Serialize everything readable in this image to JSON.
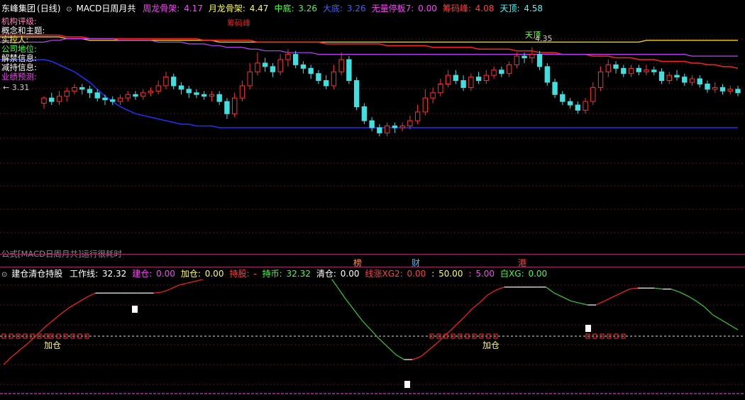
{
  "top_header": {
    "stock_name": "东峰集团",
    "period": "(日线)",
    "indicator_name": "MACD日周月共",
    "items": [
      {
        "label": "周龙骨架:",
        "value": "4.17",
        "color": "#ff40ff"
      },
      {
        "label": "月龙骨架:",
        "value": "4.47",
        "color": "#ffff40"
      },
      {
        "label": "中底:",
        "value": "3.26",
        "color": "#40ff40"
      },
      {
        "label": "大底:",
        "value": "3.26",
        "color": "#4060ff"
      },
      {
        "label": "无量停板7:",
        "value": "0.00",
        "color": "#ff40ff"
      },
      {
        "label": "筹码峰:",
        "value": "4.08",
        "color": "#ff4040"
      },
      {
        "label": "天顶:",
        "value": "4.58",
        "color": "#40ffff"
      }
    ]
  },
  "info_labels": [
    {
      "text": "机构评级:",
      "color": "#ff80c0"
    },
    {
      "text": "概念和主题:",
      "color": "#ffffff"
    },
    {
      "text": "实控人:",
      "color": "#ffff40"
    },
    {
      "text": "公司地位:",
      "color": "#40ff40"
    },
    {
      "text": "解禁信息:",
      "color": "#ffffff"
    },
    {
      "text": "减持信息:",
      "color": "#ffffff"
    },
    {
      "text": "业绩预测:",
      "color": "#ff40ff"
    }
  ],
  "price_labels": {
    "left_low": "← 3.31",
    "high": "4.35",
    "tag_red": "筹码峰",
    "tag_green": "天顶"
  },
  "notice": "公式[MACD日周月共]运行很耗时",
  "badges": [
    {
      "text": "榜",
      "color": "#ff9040"
    },
    {
      "text": "财",
      "color": "#40c0ff"
    },
    {
      "text": "港",
      "color": "#ff4040"
    }
  ],
  "lower_header": {
    "indicator_name": "建仓清仓持股",
    "items": [
      {
        "label": "工作线:",
        "value": "32.32",
        "color": "#ffffff"
      },
      {
        "label": "建仓:",
        "value": "0.00",
        "color": "#ff40ff"
      },
      {
        "label": "加仓:",
        "value": "0.00",
        "color": "#ffff40"
      },
      {
        "label": "持股:",
        "value": "-",
        "color": "#ff4040"
      },
      {
        "label": "持币:",
        "value": "32.32",
        "color": "#40ff40"
      },
      {
        "label": "清仓:",
        "value": "0.00",
        "color": "#ffffff"
      },
      {
        "label": "线涨XG2:",
        "value": "0.00",
        "color": "#ff4040"
      },
      {
        "label": ":",
        "value": "50.00",
        "color": "#ffff40"
      },
      {
        "label": ":",
        "value": "5.00",
        "color": "#ff40ff"
      },
      {
        "label": "白XG:",
        "value": "0.00",
        "color": "#40ff40"
      }
    ]
  },
  "lower_labels": {
    "add_1": "加仓",
    "add_2": "加仓"
  },
  "candles": [
    [
      4.09,
      4.12,
      4.06,
      4.13
    ],
    [
      4.12,
      4.1,
      4.08,
      4.15
    ],
    [
      4.1,
      4.13,
      4.08,
      4.16
    ],
    [
      4.13,
      4.16,
      4.1,
      4.18
    ],
    [
      4.16,
      4.18,
      4.14,
      4.2
    ],
    [
      4.18,
      4.17,
      4.14,
      4.2
    ],
    [
      4.17,
      4.15,
      4.12,
      4.19
    ],
    [
      4.15,
      4.12,
      4.1,
      4.17
    ],
    [
      4.12,
      4.11,
      4.08,
      4.14
    ],
    [
      4.11,
      4.1,
      4.08,
      4.13
    ],
    [
      4.1,
      4.12,
      4.08,
      4.14
    ],
    [
      4.12,
      4.14,
      4.1,
      4.16
    ],
    [
      4.14,
      4.13,
      4.11,
      4.16
    ],
    [
      4.13,
      4.15,
      4.11,
      4.17
    ],
    [
      4.15,
      4.16,
      4.13,
      4.18
    ],
    [
      4.16,
      4.19,
      4.14,
      4.22
    ],
    [
      4.19,
      4.24,
      4.17,
      4.27
    ],
    [
      4.24,
      4.19,
      4.17,
      4.26
    ],
    [
      4.19,
      4.17,
      4.14,
      4.21
    ],
    [
      4.17,
      4.15,
      4.12,
      4.19
    ],
    [
      4.15,
      4.14,
      4.12,
      4.17
    ],
    [
      4.14,
      4.13,
      4.11,
      4.16
    ],
    [
      4.13,
      4.14,
      4.1,
      4.16
    ],
    [
      4.14,
      4.1,
      4.08,
      4.16
    ],
    [
      4.1,
      4.03,
      4.0,
      4.12
    ],
    [
      4.03,
      4.12,
      4.01,
      4.15
    ],
    [
      4.12,
      4.19,
      4.1,
      4.22
    ],
    [
      4.19,
      4.27,
      4.17,
      4.32
    ],
    [
      4.27,
      4.32,
      4.25,
      4.38
    ],
    [
      4.32,
      4.3,
      4.27,
      4.35
    ],
    [
      4.3,
      4.27,
      4.24,
      4.32
    ],
    [
      4.27,
      4.34,
      4.25,
      4.37
    ],
    [
      4.34,
      4.37,
      4.3,
      4.4
    ],
    [
      4.37,
      4.31,
      4.29,
      4.39
    ],
    [
      4.31,
      4.29,
      4.26,
      4.33
    ],
    [
      4.29,
      4.26,
      4.23,
      4.31
    ],
    [
      4.26,
      4.22,
      4.2,
      4.28
    ],
    [
      4.22,
      4.19,
      4.17,
      4.25
    ],
    [
      4.19,
      4.27,
      4.17,
      4.31
    ],
    [
      4.27,
      4.34,
      4.25,
      4.38
    ],
    [
      4.34,
      4.22,
      4.2,
      4.36
    ],
    [
      4.22,
      4.07,
      4.05,
      4.24
    ],
    [
      4.07,
      3.99,
      3.97,
      4.09
    ],
    [
      3.99,
      3.95,
      3.93,
      4.01
    ],
    [
      3.95,
      3.92,
      3.9,
      3.97
    ],
    [
      3.92,
      3.96,
      3.9,
      3.98
    ],
    [
      3.96,
      3.95,
      3.92,
      3.98
    ],
    [
      3.95,
      3.96,
      3.93,
      3.98
    ],
    [
      3.96,
      3.99,
      3.94,
      4.02
    ],
    [
      3.99,
      4.04,
      3.97,
      4.08
    ],
    [
      4.04,
      4.12,
      4.02,
      4.17
    ],
    [
      4.12,
      4.15,
      4.09,
      4.18
    ],
    [
      4.15,
      4.2,
      4.13,
      4.23
    ],
    [
      4.2,
      4.25,
      4.18,
      4.28
    ],
    [
      4.25,
      4.22,
      4.2,
      4.28
    ],
    [
      4.22,
      4.18,
      4.16,
      4.25
    ],
    [
      4.18,
      4.24,
      4.16,
      4.26
    ],
    [
      4.24,
      4.22,
      4.2,
      4.27
    ],
    [
      4.22,
      4.25,
      4.2,
      4.28
    ],
    [
      4.25,
      4.28,
      4.23,
      4.3
    ],
    [
      4.28,
      4.26,
      4.24,
      4.3
    ],
    [
      4.26,
      4.31,
      4.24,
      4.33
    ],
    [
      4.31,
      4.36,
      4.29,
      4.38
    ],
    [
      4.36,
      4.35,
      4.32,
      4.38
    ],
    [
      4.35,
      4.37,
      4.32,
      4.41
    ],
    [
      4.37,
      4.3,
      4.28,
      4.39
    ],
    [
      4.3,
      4.21,
      4.19,
      4.32
    ],
    [
      4.21,
      4.14,
      4.12,
      4.23
    ],
    [
      4.14,
      4.1,
      4.08,
      4.16
    ],
    [
      4.1,
      4.08,
      4.06,
      4.12
    ],
    [
      4.08,
      4.05,
      4.03,
      4.1
    ],
    [
      4.05,
      4.1,
      4.03,
      4.12
    ],
    [
      4.1,
      4.18,
      4.08,
      4.21
    ],
    [
      4.18,
      4.27,
      4.16,
      4.3
    ],
    [
      4.27,
      4.31,
      4.24,
      4.34
    ],
    [
      4.31,
      4.29,
      4.26,
      4.33
    ],
    [
      4.29,
      4.26,
      4.24,
      4.31
    ],
    [
      4.26,
      4.29,
      4.24,
      4.31
    ],
    [
      4.29,
      4.27,
      4.25,
      4.31
    ],
    [
      4.27,
      4.28,
      4.25,
      4.31
    ],
    [
      4.28,
      4.27,
      4.25,
      4.3
    ],
    [
      4.27,
      4.22,
      4.2,
      4.29
    ],
    [
      4.22,
      4.25,
      4.2,
      4.27
    ],
    [
      4.25,
      4.24,
      4.22,
      4.28
    ],
    [
      4.24,
      4.21,
      4.19,
      4.26
    ],
    [
      4.21,
      4.23,
      4.19,
      4.25
    ],
    [
      4.23,
      4.2,
      4.18,
      4.25
    ],
    [
      4.2,
      4.17,
      4.15,
      4.22
    ],
    [
      4.17,
      4.18,
      4.15,
      4.21
    ],
    [
      4.18,
      4.16,
      4.14,
      4.2
    ],
    [
      4.16,
      4.17,
      4.14,
      4.19
    ],
    [
      4.17,
      4.15,
      4.13,
      4.19
    ]
  ],
  "yellow_line": [
    4.47,
    4.47,
    4.47,
    4.46,
    4.46,
    4.46,
    4.45,
    4.45,
    4.45,
    4.45,
    4.45,
    4.45,
    4.45,
    4.45,
    4.45,
    4.45,
    4.45,
    4.45,
    4.45,
    4.45,
    4.45,
    4.45,
    4.45,
    4.44,
    4.44,
    4.44,
    4.44,
    4.44,
    4.44,
    4.44,
    4.44,
    4.44,
    4.44,
    4.44,
    4.44,
    4.44,
    4.44,
    4.44,
    4.44,
    4.44,
    4.44,
    4.44,
    4.44,
    4.44,
    4.44,
    4.44,
    4.44,
    4.44,
    4.44,
    4.44,
    4.44,
    4.44,
    4.44,
    4.44,
    4.44,
    4.44,
    4.44,
    4.44,
    4.44,
    4.44,
    4.44,
    4.44,
    4.44,
    4.44,
    4.44,
    4.44,
    4.44,
    4.44,
    4.44,
    4.44,
    4.44,
    4.44,
    4.44,
    4.44,
    4.44,
    4.44,
    4.44,
    4.44,
    4.44,
    4.45,
    4.45,
    4.45,
    4.45,
    4.45,
    4.45,
    4.45,
    4.45,
    4.45,
    4.45,
    4.45,
    4.45,
    4.45
  ],
  "red_line": [
    4.48,
    4.48,
    4.48,
    4.47,
    4.47,
    4.47,
    4.46,
    4.46,
    4.46,
    4.46,
    4.46,
    4.46,
    4.46,
    4.46,
    4.46,
    4.46,
    4.46,
    4.46,
    4.46,
    4.46,
    4.46,
    4.45,
    4.45,
    4.45,
    4.45,
    4.45,
    4.45,
    4.45,
    4.44,
    4.44,
    4.44,
    4.44,
    4.44,
    4.44,
    4.44,
    4.44,
    4.44,
    4.43,
    4.43,
    4.43,
    4.43,
    4.43,
    4.43,
    4.43,
    4.43,
    4.42,
    4.42,
    4.42,
    4.42,
    4.42,
    4.42,
    4.41,
    4.41,
    4.41,
    4.41,
    4.41,
    4.41,
    4.4,
    4.4,
    4.4,
    4.4,
    4.4,
    4.39,
    4.39,
    4.39,
    4.38,
    4.38,
    4.38,
    4.37,
    4.37,
    4.37,
    4.37,
    4.36,
    4.36,
    4.36,
    4.35,
    4.35,
    4.35,
    4.34,
    4.34,
    4.34,
    4.33,
    4.33,
    4.33,
    4.33,
    4.32,
    4.32,
    4.31,
    4.31,
    4.3,
    4.3,
    4.29
  ],
  "magenta_line": [
    4.44,
    4.45,
    4.45,
    4.46,
    4.46,
    4.46,
    4.46,
    4.46,
    4.46,
    4.46,
    4.45,
    4.45,
    4.45,
    4.45,
    4.45,
    4.44,
    4.44,
    4.44,
    4.44,
    4.43,
    4.43,
    4.43,
    4.42,
    4.42,
    4.41,
    4.41,
    4.41,
    4.4,
    4.4,
    4.39,
    4.39,
    4.39,
    4.38,
    4.38,
    4.38,
    4.38,
    4.37,
    4.37,
    4.37,
    4.37,
    4.37,
    4.37,
    4.37,
    4.37,
    4.37,
    4.37,
    4.37,
    4.37,
    4.37,
    4.37,
    4.37,
    4.37,
    4.37,
    4.37,
    4.37,
    4.37,
    4.37,
    4.37,
    4.37,
    4.37,
    4.37,
    4.37,
    4.37,
    4.37,
    4.37,
    4.37,
    4.37,
    4.37,
    4.37,
    4.37,
    4.37,
    4.37,
    4.37,
    4.37,
    4.37,
    4.37,
    4.37,
    4.37,
    4.37,
    4.37,
    4.37,
    4.37,
    4.37,
    4.37,
    4.37,
    4.36,
    4.36,
    4.36,
    4.36,
    4.36,
    4.36,
    4.36
  ],
  "blue_line": [
    4.34,
    4.33,
    4.31,
    4.29,
    4.27,
    4.24,
    4.21,
    4.17,
    4.13,
    4.1,
    4.07,
    4.05,
    4.03,
    4.02,
    4.01,
    4.0,
    3.99,
    3.98,
    3.97,
    3.97,
    3.96,
    3.96,
    3.96,
    3.95,
    3.95,
    3.95,
    3.95,
    3.95,
    3.95,
    3.95,
    3.95,
    3.95,
    3.95,
    3.95,
    3.95,
    3.95,
    3.95,
    3.95,
    3.95,
    3.95,
    3.95,
    3.95,
    3.95,
    3.95,
    3.95,
    3.95,
    3.95,
    3.95,
    3.95,
    3.95,
    3.95,
    3.95,
    3.95,
    3.95,
    3.95,
    3.95,
    3.95,
    3.95,
    3.95,
    3.95,
    3.95,
    3.95,
    3.95,
    3.95,
    3.95,
    3.95,
    3.95,
    3.95,
    3.95,
    3.95,
    3.95,
    3.95,
    3.95,
    3.95,
    3.95,
    3.95,
    3.95,
    3.95,
    3.95,
    3.95,
    3.95,
    3.95,
    3.95,
    3.95,
    3.95,
    3.95,
    3.95,
    3.95,
    3.95,
    3.95,
    3.95,
    3.95
  ],
  "work_line": [
    0,
    8,
    15,
    22,
    30,
    38,
    45,
    52,
    58,
    63,
    68,
    72,
    72,
    72,
    72,
    72,
    72,
    72,
    72,
    73,
    76,
    80,
    82,
    84,
    86,
    87,
    88,
    88,
    89,
    90,
    91,
    93,
    95,
    97,
    99,
    100,
    100,
    100,
    100,
    90,
    78,
    66,
    55,
    44,
    35,
    26,
    18,
    10,
    5,
    5,
    8,
    15,
    22,
    30,
    38,
    46,
    55,
    62,
    70,
    75,
    78,
    78,
    78,
    78,
    78,
    78,
    72,
    68,
    64,
    62,
    60,
    60,
    64,
    68,
    72,
    76,
    77,
    77,
    77,
    76,
    76,
    73,
    69,
    64,
    58,
    50,
    45,
    40,
    35
  ]
}
